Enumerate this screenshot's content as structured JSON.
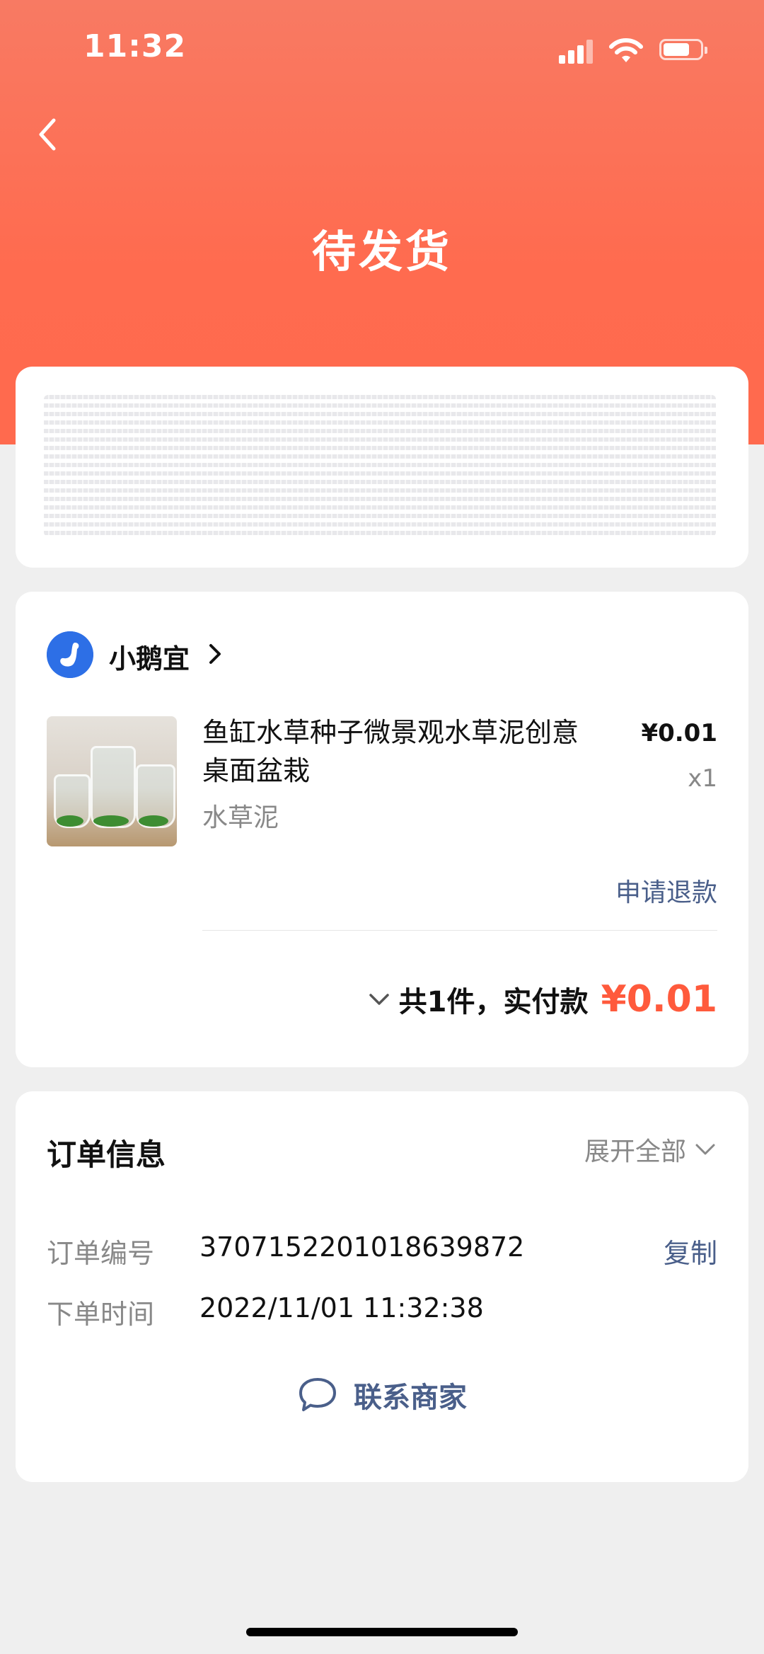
{
  "status_bar": {
    "time": "11:32"
  },
  "header": {
    "title": "待发货"
  },
  "order": {
    "shop_name": "小鹅宜",
    "product": {
      "title": "鱼缸水草种子微景观水草泥创意桌面盆栽",
      "spec": "水草泥",
      "price": "¥0.01",
      "qty": "x1"
    },
    "refund_label": "申请退款",
    "total_text": "共1件，实付款",
    "total_price": "¥0.01"
  },
  "order_info": {
    "title": "订单信息",
    "expand_label": "展开全部",
    "rows": [
      {
        "label": "订单编号",
        "value": "3707152201018639872",
        "action": "复制"
      },
      {
        "label": "下单时间",
        "value": "2022/11/01 11:32:38"
      }
    ],
    "contact_label": "联系商家"
  },
  "colors": {
    "header": "#ff6a4e",
    "accent_price": "#ff5a3c",
    "link": "#4a5f8a",
    "shop_avatar": "#2d6fe6"
  }
}
